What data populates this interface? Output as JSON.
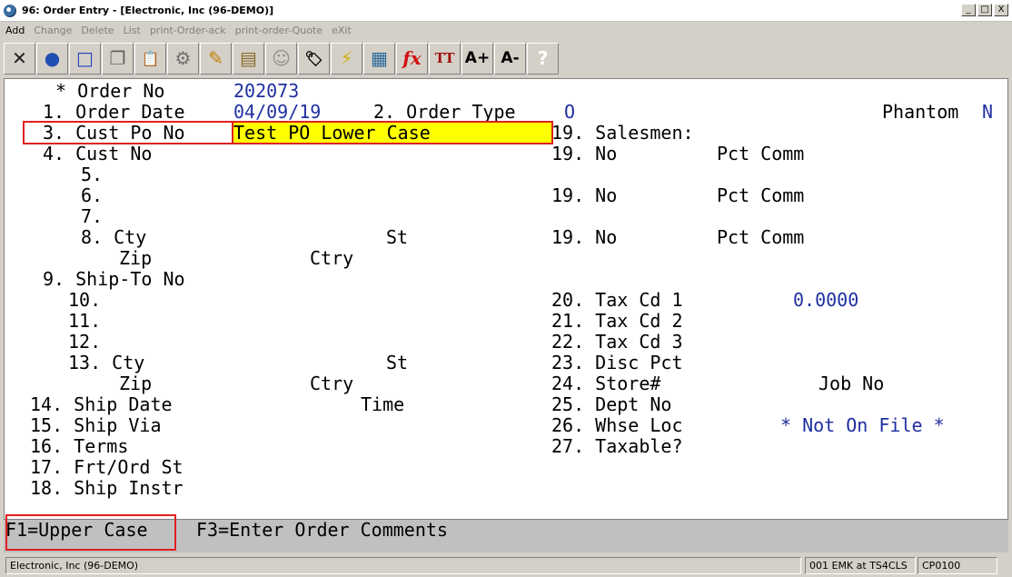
{
  "window": {
    "title": "96: Order Entry - [Electronic, Inc (96-DEMO)]",
    "minimize": "_",
    "restore": "□",
    "close": "X"
  },
  "menu": [
    "Add",
    "Change",
    "Delete",
    "List",
    "print-Order-ack",
    "print-order-Quote",
    "eXit"
  ],
  "toolbar": {
    "icons": [
      "close-x-icon",
      "globe-icon",
      "select-box-icon",
      "copy-icon",
      "paste-icon",
      "settings-gear-icon",
      "edit-pencil-icon",
      "notepad-icon",
      "users-icon",
      "tag-icon",
      "lightning-icon",
      "calendar-icon",
      "function-fx-icon",
      "font-size-icon",
      "font-increase-icon",
      "font-decrease-icon",
      "help-icon"
    ],
    "glyphs": [
      "✕",
      "●",
      "□",
      "❐",
      "📋",
      "⚙",
      "✎",
      "▤",
      "☺",
      "🏷",
      "⚡",
      "▦",
      "fx",
      "TT",
      "A+",
      "A-",
      "?"
    ]
  },
  "form": {
    "order_no_label": "* Order No",
    "order_no": "202073",
    "f1_label": "1. Order Date",
    "order_date": "04/09/19",
    "f2_label": "2. Order Type",
    "order_type": "O",
    "phantom_label": "Phantom",
    "phantom": "N",
    "f3_label": "3. Cust Po No",
    "cust_po_no": "Test PO Lower Case",
    "f19_salesmen": "19. Salesmen:",
    "f4_label": "4. Cust No",
    "f19_a": "19. No",
    "pct_comm_a": "Pct Comm",
    "f5": "5.",
    "f6": "6.",
    "f19_b": "19. No",
    "pct_comm_b": "Pct Comm",
    "f7": "7.",
    "f8_cty": "8. Cty",
    "f8_st": "St",
    "f19_c": "19. No",
    "pct_comm_c": "Pct Comm",
    "f8_zip": "Zip",
    "f8_ctry": "Ctry",
    "f9_label": "9. Ship-To No",
    "f10": "10.",
    "f20_label": "20. Tax Cd 1",
    "tax_cd_1": "0.0000",
    "f11": "11.",
    "f21_label": "21. Tax Cd 2",
    "f12": "12.",
    "f22_label": "22. Tax Cd 3",
    "f13_cty": "13. Cty",
    "f13_st": "St",
    "f23_label": "23. Disc Pct",
    "f13_zip": "Zip",
    "f13_ctry": "Ctry",
    "f24_label": "24. Store#",
    "job_no_label": "Job No",
    "f14_label": "14. Ship Date",
    "time_label": "Time",
    "f25_label": "25. Dept No",
    "f15_label": "15. Ship Via",
    "f26_label": "26. Whse Loc",
    "whse_loc_status": "* Not On File *",
    "f16_label": "16. Terms",
    "f27_label": "27. Taxable?",
    "f17_label": "17. Frt/Ord St",
    "f18_label": "18. Ship Instr"
  },
  "fkeys": {
    "f1": "F1=Upper Case",
    "f3": "F3=Enter Order Comments"
  },
  "status": {
    "company": "Electronic, Inc (96-DEMO)",
    "session": "001 EMK at TS4CLS",
    "program": "CP0100"
  }
}
